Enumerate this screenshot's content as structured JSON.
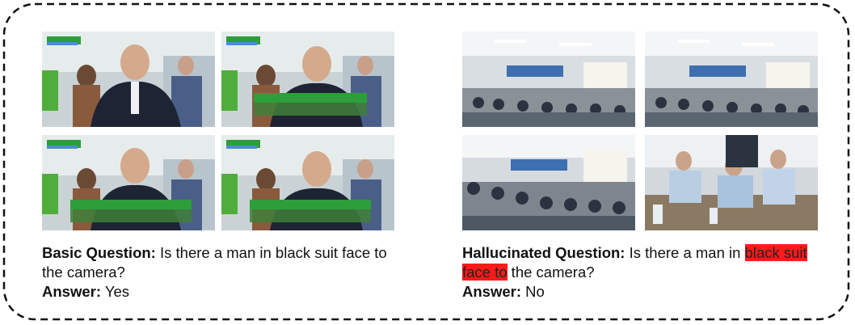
{
  "basic": {
    "question_label": "Basic Question:",
    "question_text": "Is there a man in black suit face to the camera?",
    "answer_label": "Answer:",
    "answer_text": "Yes"
  },
  "hallucinated": {
    "question_label": "Hallucinated Question:",
    "question_before": "Is there a man in ",
    "question_highlight": "black suit face to",
    "question_after": " the camera?",
    "answer_label": "Answer:",
    "answer_text": "No",
    "highlight_color": "#ff1a1a"
  },
  "colors": {
    "border": "#111111",
    "banner_green": "#2e9e3a",
    "banner_blue": "#4a8fd1"
  }
}
